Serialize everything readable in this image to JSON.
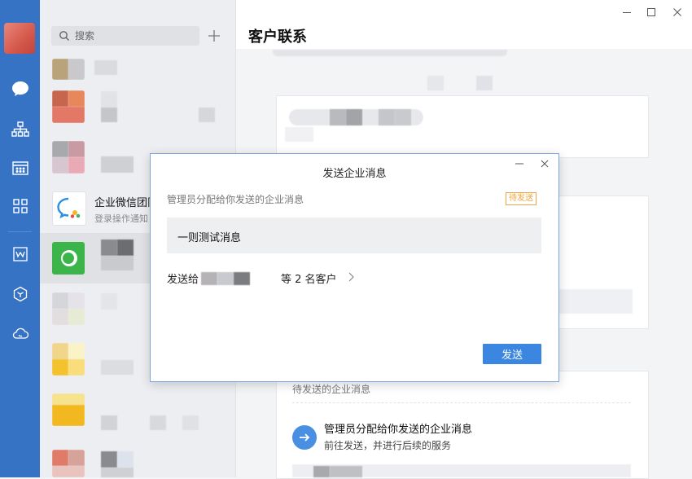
{
  "window": {
    "title": "客户联系"
  },
  "search": {
    "placeholder": "搜索"
  },
  "conversations": [
    {
      "title": "",
      "subtitle": ""
    },
    {
      "title": "",
      "subtitle": ""
    },
    {
      "title": "",
      "subtitle": ""
    },
    {
      "title": "企业微信团队",
      "subtitle": "登录操作通知"
    },
    {
      "title": "",
      "subtitle": ""
    },
    {
      "title": "",
      "subtitle": ""
    },
    {
      "title": "",
      "subtitle": ""
    },
    {
      "title": "",
      "subtitle": ""
    },
    {
      "title": "",
      "subtitle": ""
    }
  ],
  "pending": {
    "label": "待发送的企业消息",
    "title": "管理员分配给你发送的企业消息",
    "desc": "前往发送，并进行后续的服务"
  },
  "dialog": {
    "title": "发送企业消息",
    "desc": "管理员分配给你发送的企业消息",
    "badge": "待发送",
    "message": "一则测试消息",
    "send_to": "发送给",
    "count": "等 2 名客户",
    "send_label": "发送"
  },
  "colors": {
    "rail": "#3773c4",
    "accent": "#3a86e0",
    "badge": "#f0a640"
  }
}
